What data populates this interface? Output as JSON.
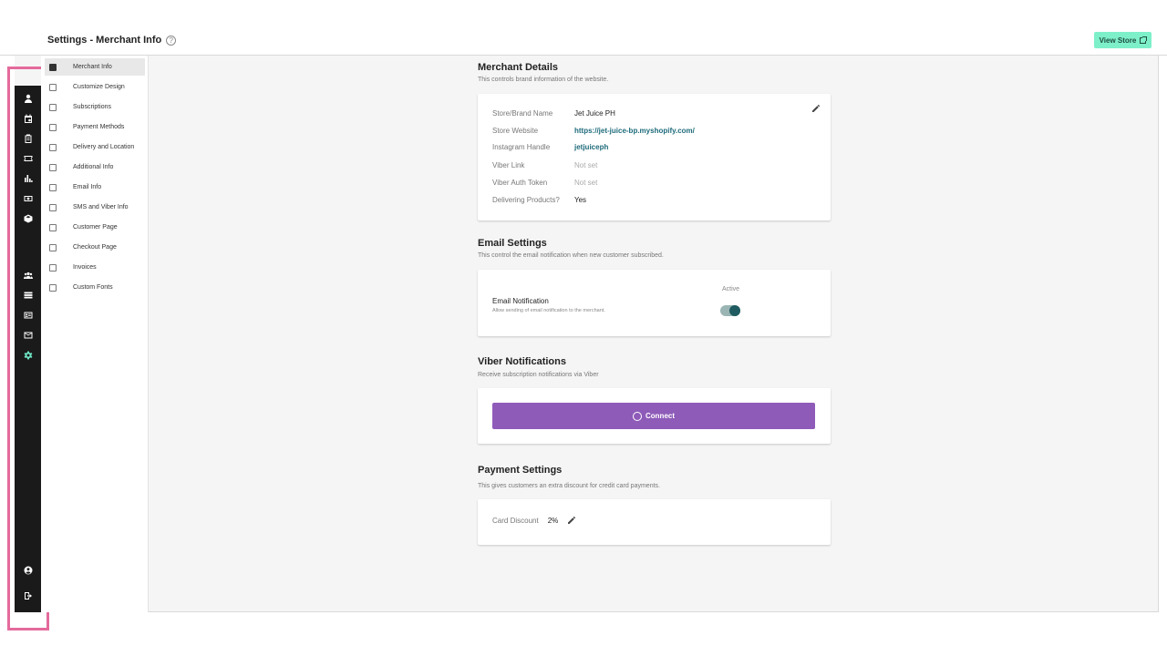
{
  "header": {
    "title": "Settings - Merchant Info",
    "view_store_label": "View Store"
  },
  "rail": {
    "icons": [
      "person-icon",
      "calendar-icon",
      "clipboard-icon",
      "ticket-icon",
      "bar-chart-icon",
      "money-icon",
      "package-icon",
      "group-icon",
      "list-icon",
      "id-card-icon",
      "mail-icon",
      "gear-icon",
      "account-circle-icon",
      "logout-icon"
    ]
  },
  "settings_nav": {
    "items": [
      {
        "label": "Merchant Info"
      },
      {
        "label": "Customize Design"
      },
      {
        "label": "Subscriptions"
      },
      {
        "label": "Payment Methods"
      },
      {
        "label": "Delivery and Location"
      },
      {
        "label": "Additional Info"
      },
      {
        "label": "Email Info"
      },
      {
        "label": "SMS and Viber Info"
      },
      {
        "label": "Customer Page"
      },
      {
        "label": "Checkout Page"
      },
      {
        "label": "Invoices"
      },
      {
        "label": "Custom Fonts"
      }
    ]
  },
  "merchant_details": {
    "title": "Merchant Details",
    "subtitle": "This controls brand information of the website.",
    "fields": [
      {
        "label": "Store/Brand Name",
        "value": "Jet Juice PH"
      },
      {
        "label": "Store Website",
        "value": "https://jet-juice-bp.myshopify.com/"
      },
      {
        "label": "Instagram Handle",
        "value": "jetjuiceph"
      },
      {
        "label": "Viber Link",
        "value": "Not set"
      },
      {
        "label": "Viber Auth Token",
        "value": "Not set"
      },
      {
        "label": "Delivering Products?",
        "value": "Yes"
      }
    ]
  },
  "email_settings": {
    "title": "Email Settings",
    "subtitle": "This control the email notification when new customer subscribed.",
    "notification_title": "Email Notification",
    "notification_desc": "Allow sending of email notification to the merchant.",
    "status_label": "Active"
  },
  "viber_notifications": {
    "title": "Viber Notifications",
    "subtitle": "Receive subscription notifications via Viber",
    "connect_label": "Connect",
    "button_color": "#8e5bb9"
  },
  "payment_settings": {
    "title": "Payment Settings",
    "subtitle": "This gives customers an extra discount for credit card payments.",
    "discount_label": "Card Discount",
    "discount_value": "2%"
  },
  "colors": {
    "accent": "#7ef0c9",
    "highlight": "#e46a9c",
    "rail": "#1a1a1a"
  }
}
